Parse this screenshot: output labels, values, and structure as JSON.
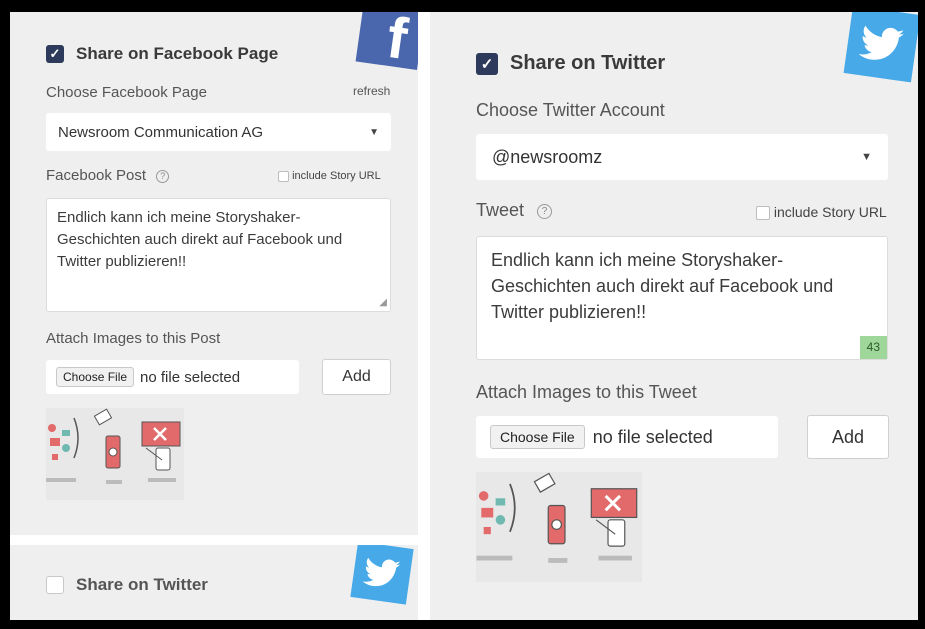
{
  "facebook": {
    "share_label": "Share on Facebook Page",
    "checked": true,
    "choose_label": "Choose Facebook Page",
    "refresh_label": "refresh",
    "selected_page": "Newsroom Communication AG",
    "post_label": "Facebook Post",
    "help_glyph": "?",
    "include_url_label": "include Story URL",
    "post_text": "Endlich kann ich meine Storyshaker-Geschichten auch direkt auf Facebook und Twitter publizieren!!",
    "attach_label": "Attach Images to this Post",
    "choose_file_label": "Choose File",
    "no_file_label": "no file selected",
    "add_label": "Add",
    "logo_glyph": "f",
    "brand_color": "#4a67ad"
  },
  "twitter_collapsed": {
    "share_label": "Share on Twitter",
    "checked": false,
    "brand_color": "#47a9e8"
  },
  "twitter": {
    "share_label": "Share on Twitter",
    "checked": true,
    "choose_label": "Choose Twitter Account",
    "selected_account": "@newsroomz",
    "tweet_label": "Tweet",
    "help_glyph": "?",
    "include_url_label": "include Story URL",
    "tweet_text": "Endlich kann ich meine Storyshaker-Geschichten auch direkt auf Facebook und Twitter publizieren!!",
    "char_count": "43",
    "attach_label": "Attach Images to this Tweet",
    "choose_file_label": "Choose File",
    "no_file_label": "no file selected",
    "add_label": "Add",
    "brand_color": "#47a9e8",
    "counter_color": "#9fd79a"
  },
  "check_glyph": "✓",
  "caret_glyph": "▼"
}
